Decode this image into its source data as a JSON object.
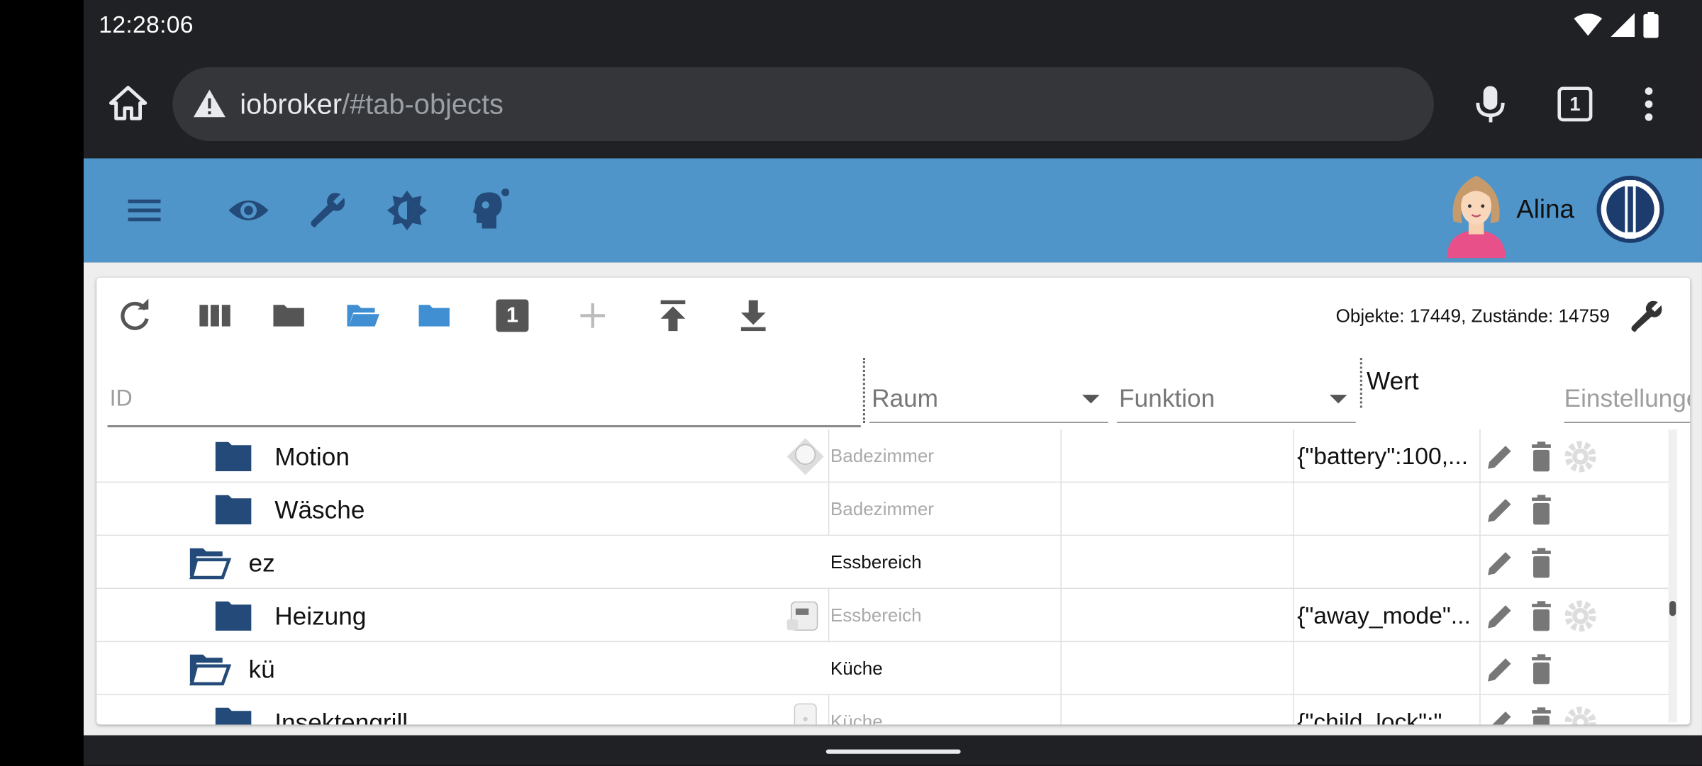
{
  "status": {
    "time": "12:28:06"
  },
  "browser": {
    "url_host": "iobroker",
    "url_path": "/#tab-objects",
    "tab_count": "1"
  },
  "header": {
    "user": "Alina"
  },
  "toolbar": {
    "counts": "Objekte: 17449, Zustände: 14759",
    "badge_number": "1"
  },
  "columns": {
    "id_placeholder": "ID",
    "raum": "Raum",
    "funktion": "Funktion",
    "wert": "Wert",
    "einstellungen": "Einstellungen"
  },
  "rows": [
    {
      "name": "Motion",
      "raum": "Badezimmer",
      "wert": "{\"battery\":100,...",
      "has_gear": true
    },
    {
      "name": "Wäsche",
      "raum": "Badezimmer",
      "wert": "",
      "has_gear": false
    },
    {
      "name": "ez",
      "raum": "Essbereich",
      "wert": "",
      "has_gear": false
    },
    {
      "name": "Heizung",
      "raum": "Essbereich",
      "wert": "{\"away_mode\"...",
      "has_gear": true
    },
    {
      "name": "kü",
      "raum": "Küche",
      "wert": "",
      "has_gear": false
    },
    {
      "name": "Insektengrill",
      "raum": "Küche",
      "wert": "{\"child_lock\":\"...",
      "has_gear": true
    }
  ],
  "colors": {
    "appbar": "#5095c9",
    "folder": "#234a78",
    "accent": "#3f8fd2"
  }
}
